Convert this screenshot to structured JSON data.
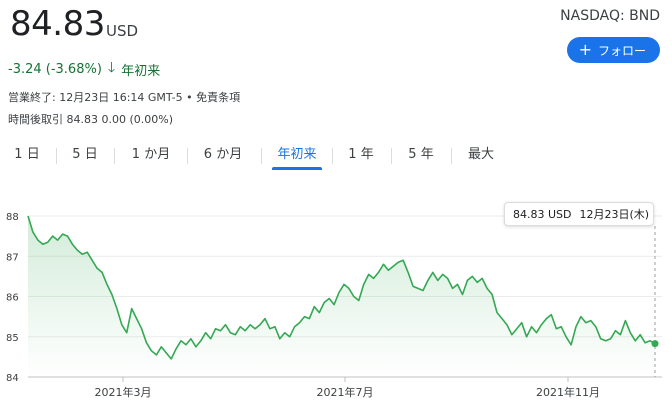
{
  "quote": {
    "price": "84.83",
    "currency": "USD",
    "ticker": "NASDAQ: BND",
    "follow_label": "フォロー",
    "change": "-3.24 (-3.68%)",
    "change_period": "年初来",
    "closed_info": "営業終了: 12月23日 16:14 GMT-5 • 免責条項",
    "after_hours": "時間後取引 84.83 0.00 (0.00%)"
  },
  "tabs": [
    "1 日",
    "5 日",
    "1 か月",
    "6 か月",
    "年初来",
    "1 年",
    "5 年",
    "最大"
  ],
  "active_tab": "年初来",
  "tooltip": {
    "value": "84.83 USD",
    "date": "12月23日(木)"
  },
  "colors": {
    "line": "#34a853",
    "fill": "#e6f4ea",
    "accent": "#1a73e8",
    "down": "#137333"
  },
  "chart_data": {
    "type": "area",
    "ylim": [
      84,
      88
    ],
    "yticks": [
      "88",
      "87",
      "86",
      "85",
      "84"
    ],
    "xticks": [
      "2021年3月",
      "2021年7月",
      "2021年11月"
    ],
    "series": [
      {
        "values": [
          88.0,
          87.6,
          87.4,
          87.3,
          87.35,
          87.5,
          87.4,
          87.55,
          87.5,
          87.3,
          87.15,
          87.05,
          87.1,
          86.9,
          86.7,
          86.6,
          86.3,
          86.05,
          85.7,
          85.3,
          85.1,
          85.7,
          85.45,
          85.2,
          84.85,
          84.65,
          84.55,
          84.75,
          84.6,
          84.45,
          84.7,
          84.9,
          84.8,
          84.95,
          84.75,
          84.9,
          85.1,
          84.95,
          85.2,
          85.15,
          85.3,
          85.1,
          85.05,
          85.25,
          85.15,
          85.3,
          85.2,
          85.3,
          85.45,
          85.2,
          85.25,
          84.95,
          85.1,
          85.0,
          85.25,
          85.35,
          85.5,
          85.45,
          85.75,
          85.6,
          85.85,
          85.95,
          85.8,
          86.1,
          86.3,
          86.2,
          86.0,
          85.9,
          86.3,
          86.55,
          86.45,
          86.6,
          86.8,
          86.65,
          86.75,
          86.85,
          86.9,
          86.6,
          86.25,
          86.2,
          86.15,
          86.4,
          86.6,
          86.4,
          86.55,
          86.45,
          86.2,
          86.3,
          86.05,
          86.4,
          86.5,
          86.35,
          86.45,
          86.2,
          86.05,
          85.6,
          85.45,
          85.3,
          85.05,
          85.2,
          85.35,
          85.0,
          85.25,
          85.1,
          85.3,
          85.45,
          85.55,
          85.2,
          85.25,
          85.0,
          84.8,
          85.25,
          85.5,
          85.35,
          85.4,
          85.25,
          84.95,
          84.9,
          84.95,
          85.15,
          85.05,
          85.4,
          85.1,
          84.9,
          85.05,
          84.85,
          84.9,
          84.83
        ]
      }
    ]
  }
}
